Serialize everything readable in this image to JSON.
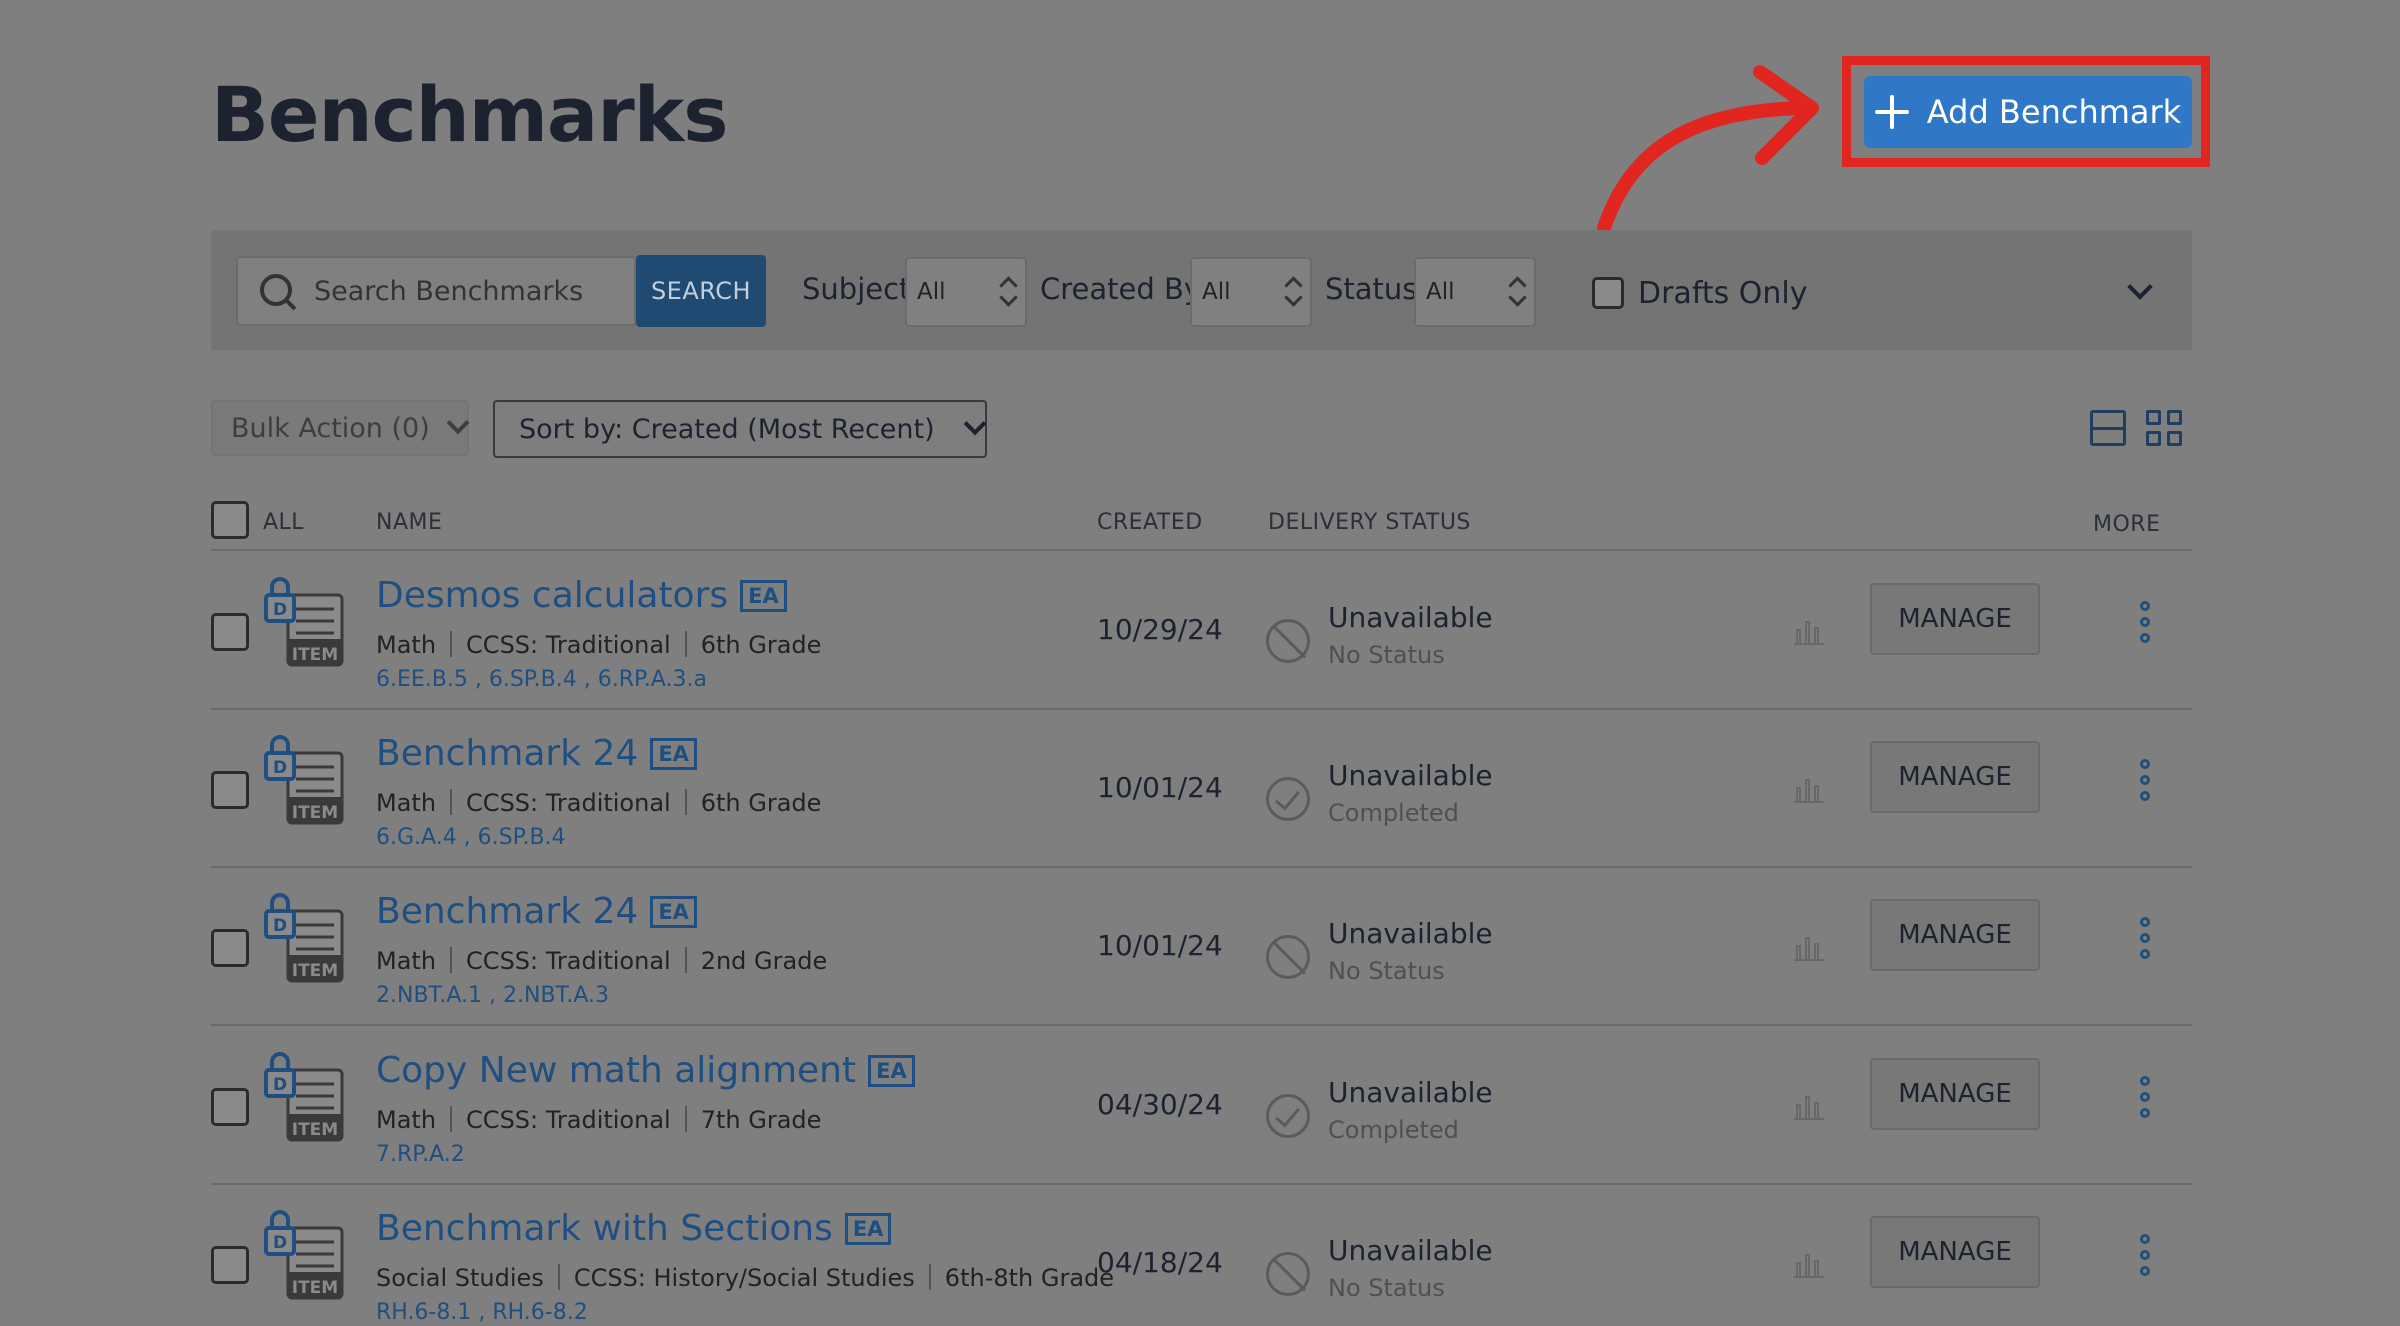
{
  "header": {
    "title": "Benchmarks",
    "add_button_label": "Add Benchmark"
  },
  "filters": {
    "search_placeholder": "Search Benchmarks",
    "search_button": "SEARCH",
    "subject_label": "Subject",
    "subject_value": "All",
    "created_by_label": "Created By",
    "created_by_value": "All",
    "status_label": "Status",
    "status_value": "All",
    "drafts_only_label": "Drafts Only"
  },
  "toolbar": {
    "bulk_action_label": "Bulk Action (0)",
    "sort_label": "Sort by: Created (Most Recent)"
  },
  "table": {
    "headers": {
      "all": "ALL",
      "name": "NAME",
      "created": "CREATED",
      "delivery_status": "DELIVERY STATUS",
      "more": "MORE"
    },
    "manage_label": "MANAGE",
    "badge_label": "EA",
    "item_icon_letter": "D",
    "item_icon_text": "ITEM",
    "rows": [
      {
        "name": "Desmos calculators",
        "subject": "Math",
        "framework": "CCSS: Traditional",
        "grade": "6th Grade",
        "standards": "6.EE.B.5 , 6.SP.B.4 , 6.RP.A.3.a",
        "created": "10/29/24",
        "status": "Unavailable",
        "status_sub": "No Status",
        "status_icon": "ban-icon"
      },
      {
        "name": "Benchmark 24",
        "subject": "Math",
        "framework": "CCSS: Traditional",
        "grade": "6th Grade",
        "standards": "6.G.A.4 , 6.SP.B.4",
        "created": "10/01/24",
        "status": "Unavailable",
        "status_sub": "Completed",
        "status_icon": "check-circle-icon"
      },
      {
        "name": "Benchmark 24",
        "subject": "Math",
        "framework": "CCSS: Traditional",
        "grade": "2nd Grade",
        "standards": "2.NBT.A.1 , 2.NBT.A.3",
        "created": "10/01/24",
        "status": "Unavailable",
        "status_sub": "No Status",
        "status_icon": "ban-icon"
      },
      {
        "name": "Copy New math alignment",
        "subject": "Math",
        "framework": "CCSS: Traditional",
        "grade": "7th Grade",
        "standards": "7.RP.A.2",
        "created": "04/30/24",
        "status": "Unavailable",
        "status_sub": "Completed",
        "status_icon": "check-circle-icon"
      },
      {
        "name": "Benchmark with Sections",
        "subject": "Social Studies",
        "framework": "CCSS: History/Social Studies",
        "grade": "6th-8th Grade",
        "standards": "RH.6-8.1 , RH.6-8.2",
        "created": "04/18/24",
        "status": "Unavailable",
        "status_sub": "No Status",
        "status_icon": "ban-icon"
      }
    ]
  },
  "colors": {
    "overlay_bg": "#7f7f7f",
    "primary_button": "#2f78c8",
    "highlight": "#e0261e",
    "link": "#1f4f80"
  }
}
